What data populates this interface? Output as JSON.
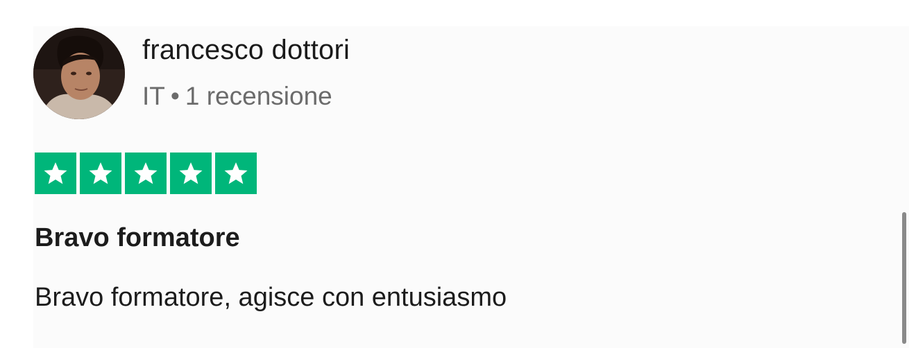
{
  "reviewer": {
    "name": "francesco dottori",
    "country": "IT",
    "separator": "•",
    "review_count": "1 recensione",
    "avatar_icon": "user-photo-avatar"
  },
  "rating": {
    "stars": 5,
    "max_stars": 5,
    "color": "#00b67a",
    "star_icon": "star-icon"
  },
  "review": {
    "title": "Bravo formatore",
    "text": "Bravo formatore, agisce con entusiasmo"
  }
}
